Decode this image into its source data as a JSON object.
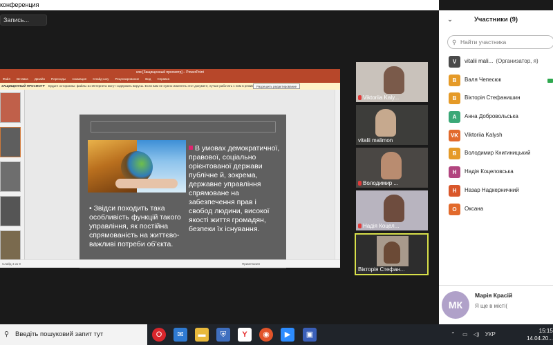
{
  "window": {
    "title": "конференция"
  },
  "recording": {
    "label": "Запись..."
  },
  "powerpoint": {
    "title": "ков [Защищенный просмотр] – PowerPoint",
    "ribbon_tabs": [
      "Файл",
      "Вставка",
      "Дизайн",
      "Переходы",
      "Анимация",
      "Слайд-шоу",
      "Рецензирование",
      "Вид",
      "Справка"
    ],
    "protected_label": "ЗАЩИЩЕННЫЙ ПРОСМОТР",
    "warning_text": "Будьте осторожны: файлы из Интернета могут содержать вирусы. Если вам не нужно изменять этот документ, лучше работать с ним в режиме защищенного просмотра.",
    "enable_editing": "Разрешить редактирование",
    "status_left": "Слайд 4 из 9",
    "status_right": "Примечания",
    "slide": {
      "left_text": "•   Звідси походить така особливість функцій такого управління, як постійна спрямованість на життєво-важливі потреби об’єкта.",
      "right_text": "В умовах демократичної, правової, соціально орієнтованої держави публічне й, зокрема, державне управління спрямоване на забезпечення прав і свобод людини, високої якості життя громадян, безпеки їх існування."
    }
  },
  "videos": [
    {
      "name": "Viktoriia Kaly...",
      "muted": true
    },
    {
      "name": "vitalii malimon",
      "muted": false
    },
    {
      "name": "Володимир ...",
      "muted": true
    },
    {
      "name": "Надія Коцел...",
      "muted": true
    },
    {
      "name": "Вікторія Стефан...",
      "muted": false
    }
  ],
  "participants_panel": {
    "title": "Участники (9)",
    "search_placeholder": "Найти участника",
    "participants": [
      {
        "initials": "V",
        "name": "vitalii mali...",
        "role": "(Организатор, я)",
        "color": "#4a4a4a"
      },
      {
        "initials": "В",
        "name": "Валя Чепесюк",
        "role": "",
        "color": "#e59a27"
      },
      {
        "initials": "В",
        "name": "Вікторія Стефанишин",
        "role": "",
        "color": "#e59a27"
      },
      {
        "initials": "А",
        "name": " Анна Добровольська",
        "role": "",
        "color": "#3aa877"
      },
      {
        "initials": "VK",
        "name": "Viktoriia Kalysh",
        "role": "",
        "color": "#e26a2c"
      },
      {
        "initials": "В",
        "name": "Володимир Книгиницький",
        "role": "",
        "color": "#e59a27"
      },
      {
        "initials": "Н",
        "name": "Надія Коцеловська",
        "role": "",
        "color": "#b2457f"
      },
      {
        "initials": "Н",
        "name": "Назар Надкерничний",
        "role": "",
        "color": "#d9572a"
      },
      {
        "initials": "О",
        "name": "Оксана",
        "role": "",
        "color": "#e26a2c"
      }
    ]
  },
  "chat": {
    "initials": "МК",
    "name": "Марія Красій",
    "message": "Я ще в місті("
  },
  "taskbar": {
    "search_placeholder": "Введіть пошуковий запит тут",
    "tray_lang": "УКР",
    "time": "15:15",
    "date": "14.04.20..."
  }
}
